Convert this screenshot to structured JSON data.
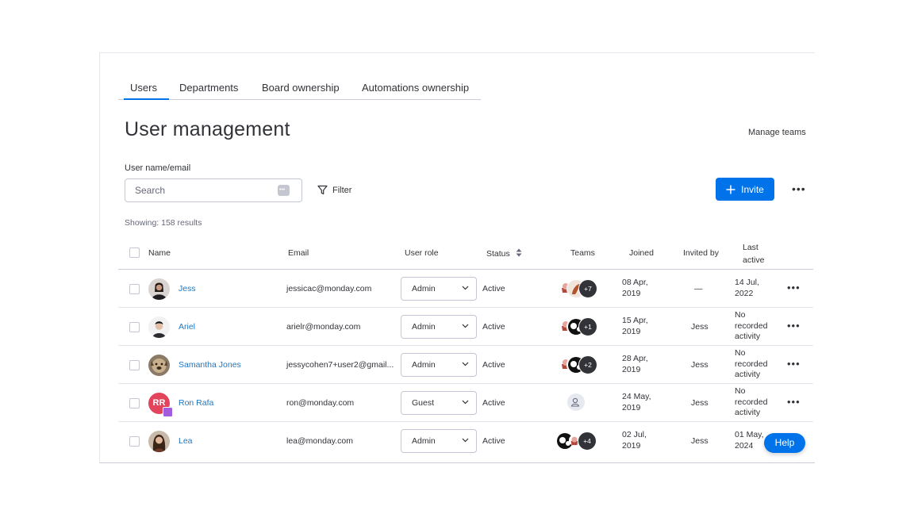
{
  "tabs": [
    {
      "label": "Users",
      "active": true
    },
    {
      "label": "Departments",
      "active": false
    },
    {
      "label": "Board ownership",
      "active": false
    },
    {
      "label": "Automations ownership",
      "active": false
    }
  ],
  "page_title": "User management",
  "manage_teams_label": "Manage teams",
  "search": {
    "label": "User name/email",
    "placeholder": "Search"
  },
  "filter_label": "Filter",
  "invite_label": "Invite",
  "showing_text": "Showing: 158 results",
  "columns": {
    "name": "Name",
    "email": "Email",
    "role": "User role",
    "status": "Status",
    "teams": "Teams",
    "joined": "Joined",
    "invited_by": "Invited by",
    "last_active": "Last active"
  },
  "users": [
    {
      "name": "Jess",
      "email": "jessicac@monday.com",
      "role": "Admin",
      "status": "Active",
      "teams_extra": "+7",
      "joined": "08 Apr, 2019",
      "invited_by": "—",
      "last_active": "14 Jul, 2022"
    },
    {
      "name": "Ariel",
      "email": "arielr@monday.com",
      "role": "Admin",
      "status": "Active",
      "teams_extra": "+1",
      "joined": "15 Apr, 2019",
      "invited_by": "Jess",
      "last_active": "No recorded activity"
    },
    {
      "name": "Samantha Jones",
      "email": "jessycohen7+user2@gmail...",
      "role": "Admin",
      "status": "Active",
      "teams_extra": "+2",
      "joined": "28 Apr, 2019",
      "invited_by": "Jess",
      "last_active": "No recorded activity"
    },
    {
      "name": "Ron Rafa",
      "initials": "RR",
      "email": "ron@monday.com",
      "role": "Guest",
      "status": "Active",
      "teams_extra": "",
      "joined": "24 May, 2019",
      "invited_by": "Jess",
      "last_active": "No recorded activity"
    },
    {
      "name": "Lea",
      "email": "lea@monday.com",
      "role": "Admin",
      "status": "Active",
      "teams_extra": "+4",
      "joined": "02 Jul, 2019",
      "invited_by": "Jess",
      "last_active": "01 May, 2024"
    }
  ],
  "help_label": "Help",
  "colors": {
    "accent": "#0073ea",
    "link": "#1f76c2",
    "text": "#323338",
    "ron_avatar": "#e2445c"
  }
}
